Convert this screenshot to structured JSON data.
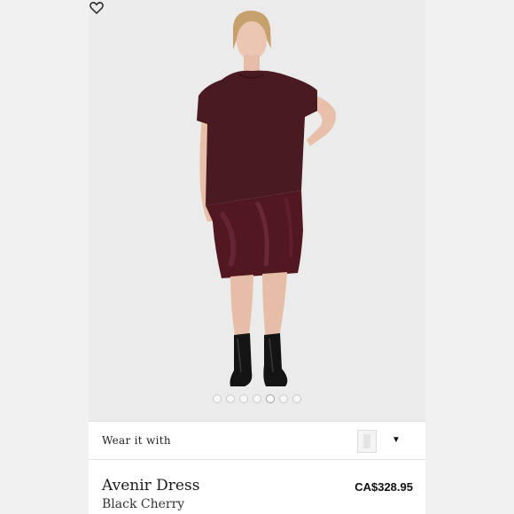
{
  "gallery": {
    "image_count": 7,
    "active_index": 4,
    "model_colors": {
      "dress_top": "#4a1a22",
      "dress_skirt": "#4e1820",
      "boots": "#141414",
      "skin": "#e8c1ad",
      "hair": "#c9a36d"
    }
  },
  "wear_it_with": {
    "label": "Wear it with",
    "caret": "▼"
  },
  "product": {
    "name": "Avenir Dress",
    "color": "Black Cherry",
    "price": "CA$328.95"
  },
  "icons": {
    "wishlist": "heart-icon",
    "expand": "caret-down-icon"
  }
}
